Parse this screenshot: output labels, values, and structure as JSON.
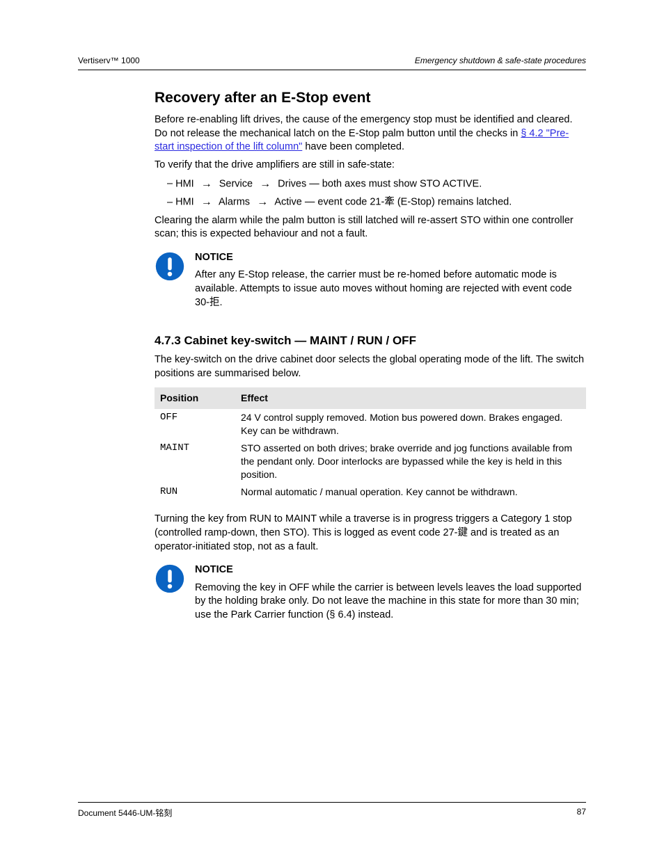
{
  "header": {
    "left": "Vertiserv™ 1000",
    "right": "Emergency shutdown & safe-state procedures"
  },
  "intro": {
    "title": "Recovery after an E-Stop event",
    "lead": "Before re-enabling lift drives, the cause of the emergency stop must be identified and cleared. Do not release the mechanical latch on the E-Stop palm button until the checks in ",
    "link_text": "§ 4.2 \"Pre-start inspection of the lift column\"",
    "tail": " have been completed.",
    "check_intro": "To verify that the drive amplifiers are still in safe-state:",
    "checks": [
      {
        "pre": "HMI ",
        "seg1": "Service",
        "seg2": "Drives",
        "tail": " — both axes must show STO ACTIVE."
      },
      {
        "pre": "HMI ",
        "seg1": "Alarms",
        "seg2": "Active",
        "tail": " — event code 21-牽 (E-Stop) remains latched."
      }
    ],
    "clear_note": "Clearing the alarm while the palm button is still latched will re-assert STO within one controller scan; this is expected behaviour and not a fault."
  },
  "notice1": {
    "label": "NOTICE",
    "text": "After any E-Stop release, the carrier must be re-homed before automatic mode is available. Attempts to issue auto moves without homing are rejected with event code 30-拒."
  },
  "section": {
    "title": "4.7.3  Cabinet key-switch — MAINT / RUN / OFF",
    "intro": "The key-switch on the drive cabinet door selects the global operating mode of the lift. The switch positions are summarised below.",
    "table": {
      "headers": [
        "Position",
        "Effect"
      ],
      "rows": [
        [
          "OFF",
          "24 V control supply removed. Motion bus powered down. Brakes engaged. Key can be withdrawn."
        ],
        [
          "MAINT",
          "STO asserted on both drives; brake override and jog functions available from the pendant only. Door interlocks are bypassed while the key is held in this position."
        ],
        [
          "RUN",
          "Normal automatic / manual operation. Key cannot be withdrawn."
        ]
      ]
    },
    "post": "Turning the key from RUN to MAINT while a traverse is in progress triggers a Category 1 stop (controlled ramp-down, then STO). This is logged as event code 27-鍵 and is treated as an operator-initiated stop, not as a fault."
  },
  "notice2": {
    "label": "NOTICE",
    "text": "Removing the key in OFF while the carrier is between levels leaves the load supported by the holding brake only. Do not leave the machine in this state for more than 30 min; use the Park Carrier function (§ 6.4) instead."
  },
  "footer": {
    "left": "Document 5446-UM-铭刻",
    "right": "87"
  }
}
